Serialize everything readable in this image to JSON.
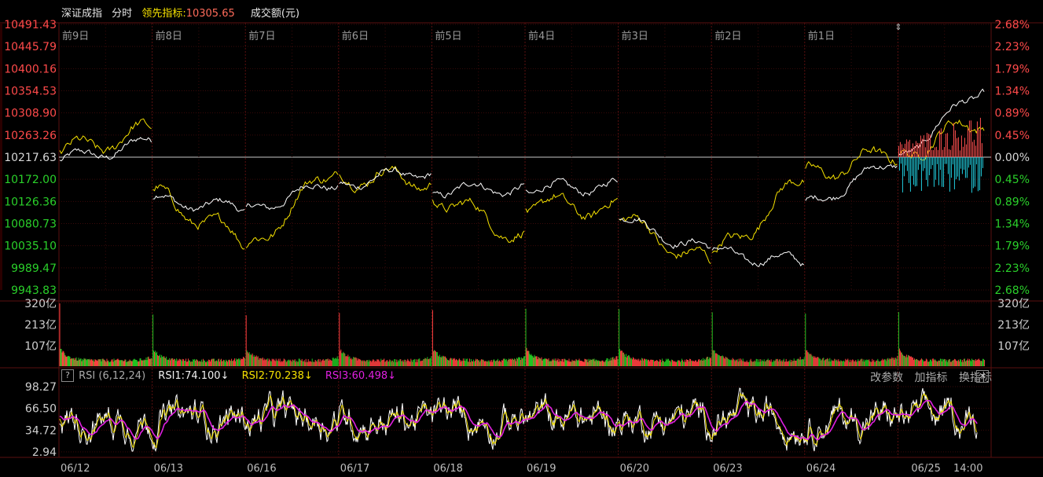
{
  "header": {
    "index_name": "深证成指",
    "period": "分时",
    "leading_label": "领先指标:",
    "leading_value": "10305.65",
    "volume_label": "成交额(元)"
  },
  "price_axis": {
    "left_labels": [
      "10491.43",
      "10445.79",
      "10400.16",
      "10354.53",
      "10308.90",
      "10263.26",
      "10217.63",
      "10172.00",
      "10126.36",
      "10080.73",
      "10035.10",
      "9989.47",
      "9943.83"
    ],
    "right_labels": [
      "2.68%",
      "2.23%",
      "1.79%",
      "1.34%",
      "0.89%",
      "0.45%",
      "0.00%",
      "0.45%",
      "0.89%",
      "1.34%",
      "1.79%",
      "2.23%",
      "2.68%"
    ],
    "max": 10491.43,
    "min": 9943.83,
    "prev_close": 10217.63
  },
  "day_labels": [
    "前9日",
    "前8日",
    "前7日",
    "前6日",
    "前5日",
    "前4日",
    "前3日",
    "前2日",
    "前1日"
  ],
  "volume_axis": {
    "labels": [
      "320亿",
      "213亿",
      "107亿"
    ],
    "max": 320
  },
  "rsi": {
    "help": "?",
    "name": "RSI (6,12,24)",
    "rsi1": "RSI1:74.100↓",
    "rsi2": "RSI2:70.238↓",
    "rsi3": "RSI3:60.498↓",
    "axis_labels": [
      "98.27",
      "66.50",
      "34.72",
      "2.94"
    ],
    "max": 98.27,
    "min": 2.94
  },
  "buttons": {
    "params": "改参数",
    "add": "加指标",
    "swap": "换指标",
    "close": "✕"
  },
  "date_labels": [
    "06/12",
    "06/13",
    "06/16",
    "06/17",
    "06/18",
    "06/19",
    "06/20",
    "06/23",
    "06/24",
    "06/25",
    "14:00"
  ],
  "colors": {
    "up": "#ff4040",
    "down": "#00d000",
    "white_line": "#ffffff",
    "yellow_line": "#f5e100",
    "rsi3": "#e020e0",
    "cyan": "#22d0e0",
    "grid": "#3a0000"
  },
  "chart_data": {
    "type": "line",
    "title": "深证成指 分时",
    "x": [
      "06/12",
      "06/13",
      "06/16",
      "06/17",
      "06/18",
      "06/19",
      "06/20",
      "06/23",
      "06/24",
      "06/25"
    ],
    "series": [
      {
        "name": "深证成指",
        "values": [
          10250,
          10110,
          10170,
          10190,
          10155,
          10160,
          10020,
          10000,
          10215,
          10380
        ]
      },
      {
        "name": "领先指标",
        "values": [
          10275,
          10040,
          10210,
          10170,
          10050,
          10110,
          9990,
          10180,
          10230,
          10305.65
        ]
      }
    ],
    "ylim": [
      9943.83,
      10491.43
    ]
  }
}
